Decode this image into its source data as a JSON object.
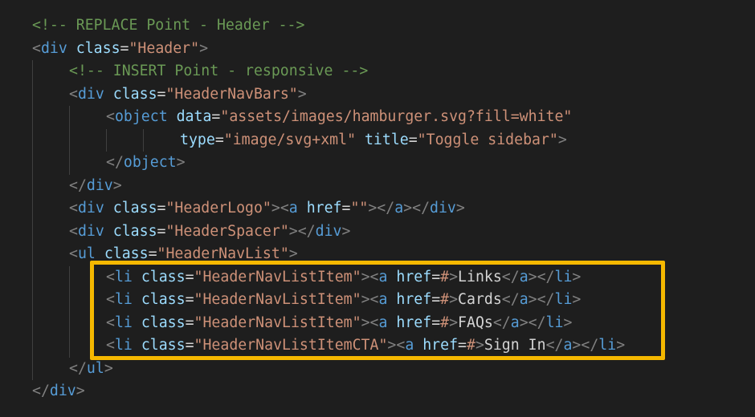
{
  "colors": {
    "background": "#1e1e1e",
    "comment": "#6a9955",
    "bracket": "#808080",
    "tag": "#569cd6",
    "attribute": "#9cdcfe",
    "string": "#ce9178",
    "text": "#d4d4d4",
    "highlight_box": "#f5b800"
  },
  "lines": [
    {
      "tokens": [
        {
          "t": "comment",
          "v": "<!-- REPLACE Point - Header -->"
        }
      ]
    },
    {
      "tokens": [
        {
          "t": "punct",
          "v": "<"
        },
        {
          "t": "tag",
          "v": "div"
        },
        {
          "t": "text",
          "v": " "
        },
        {
          "t": "attr",
          "v": "class"
        },
        {
          "t": "eq",
          "v": "="
        },
        {
          "t": "str",
          "v": "\"Header\""
        },
        {
          "t": "punct",
          "v": ">"
        }
      ]
    },
    {
      "tokens": [
        {
          "t": "comment",
          "v": "<!-- INSERT Point - responsive -->"
        }
      ]
    },
    {
      "tokens": [
        {
          "t": "punct",
          "v": "<"
        },
        {
          "t": "tag",
          "v": "div"
        },
        {
          "t": "text",
          "v": " "
        },
        {
          "t": "attr",
          "v": "class"
        },
        {
          "t": "eq",
          "v": "="
        },
        {
          "t": "str",
          "v": "\"HeaderNavBars\""
        },
        {
          "t": "punct",
          "v": ">"
        }
      ]
    },
    {
      "tokens": [
        {
          "t": "punct",
          "v": "<"
        },
        {
          "t": "tag",
          "v": "object"
        },
        {
          "t": "text",
          "v": " "
        },
        {
          "t": "attr",
          "v": "data"
        },
        {
          "t": "eq",
          "v": "="
        },
        {
          "t": "str",
          "v": "\"assets/images/hamburger.svg?fill=white\""
        }
      ]
    },
    {
      "tokens": [
        {
          "t": "attr",
          "v": "type"
        },
        {
          "t": "eq",
          "v": "="
        },
        {
          "t": "str",
          "v": "\"image/svg+xml\""
        },
        {
          "t": "text",
          "v": " "
        },
        {
          "t": "attr",
          "v": "title"
        },
        {
          "t": "eq",
          "v": "="
        },
        {
          "t": "str",
          "v": "\"Toggle sidebar\""
        },
        {
          "t": "punct",
          "v": ">"
        }
      ]
    },
    {
      "tokens": [
        {
          "t": "punct",
          "v": "</"
        },
        {
          "t": "tag",
          "v": "object"
        },
        {
          "t": "punct",
          "v": ">"
        }
      ]
    },
    {
      "tokens": [
        {
          "t": "punct",
          "v": "</"
        },
        {
          "t": "tag",
          "v": "div"
        },
        {
          "t": "punct",
          "v": ">"
        }
      ]
    },
    {
      "tokens": [
        {
          "t": "punct",
          "v": "<"
        },
        {
          "t": "tag",
          "v": "div"
        },
        {
          "t": "text",
          "v": " "
        },
        {
          "t": "attr",
          "v": "class"
        },
        {
          "t": "eq",
          "v": "="
        },
        {
          "t": "str",
          "v": "\"HeaderLogo\""
        },
        {
          "t": "punct",
          "v": "><"
        },
        {
          "t": "tag",
          "v": "a"
        },
        {
          "t": "text",
          "v": " "
        },
        {
          "t": "attr",
          "v": "href"
        },
        {
          "t": "eq",
          "v": "="
        },
        {
          "t": "str",
          "v": "\"\""
        },
        {
          "t": "punct",
          "v": "></"
        },
        {
          "t": "tag",
          "v": "a"
        },
        {
          "t": "punct",
          "v": "></"
        },
        {
          "t": "tag",
          "v": "div"
        },
        {
          "t": "punct",
          "v": ">"
        }
      ]
    },
    {
      "tokens": [
        {
          "t": "punct",
          "v": "<"
        },
        {
          "t": "tag",
          "v": "div"
        },
        {
          "t": "text",
          "v": " "
        },
        {
          "t": "attr",
          "v": "class"
        },
        {
          "t": "eq",
          "v": "="
        },
        {
          "t": "str",
          "v": "\"HeaderSpacer\""
        },
        {
          "t": "punct",
          "v": "></"
        },
        {
          "t": "tag",
          "v": "div"
        },
        {
          "t": "punct",
          "v": ">"
        }
      ]
    },
    {
      "tokens": [
        {
          "t": "punct",
          "v": "<"
        },
        {
          "t": "tag",
          "v": "ul"
        },
        {
          "t": "text",
          "v": " "
        },
        {
          "t": "attr",
          "v": "class"
        },
        {
          "t": "eq",
          "v": "="
        },
        {
          "t": "str",
          "v": "\"HeaderNavList\""
        },
        {
          "t": "punct",
          "v": ">"
        }
      ]
    },
    {
      "tokens": [
        {
          "t": "punct",
          "v": "<"
        },
        {
          "t": "tag",
          "v": "li"
        },
        {
          "t": "text",
          "v": " "
        },
        {
          "t": "attr",
          "v": "class"
        },
        {
          "t": "eq",
          "v": "="
        },
        {
          "t": "str",
          "v": "\"HeaderNavListItem\""
        },
        {
          "t": "punct",
          "v": "><"
        },
        {
          "t": "tag",
          "v": "a"
        },
        {
          "t": "text",
          "v": " "
        },
        {
          "t": "attr",
          "v": "href"
        },
        {
          "t": "eq",
          "v": "="
        },
        {
          "t": "str",
          "v": "#"
        },
        {
          "t": "punct",
          "v": ">"
        },
        {
          "t": "text",
          "v": "Links"
        },
        {
          "t": "punct",
          "v": "</"
        },
        {
          "t": "tag",
          "v": "a"
        },
        {
          "t": "punct",
          "v": "></"
        },
        {
          "t": "tag",
          "v": "li"
        },
        {
          "t": "punct",
          "v": ">"
        }
      ]
    },
    {
      "tokens": [
        {
          "t": "punct",
          "v": "<"
        },
        {
          "t": "tag",
          "v": "li"
        },
        {
          "t": "text",
          "v": " "
        },
        {
          "t": "attr",
          "v": "class"
        },
        {
          "t": "eq",
          "v": "="
        },
        {
          "t": "str",
          "v": "\"HeaderNavListItem\""
        },
        {
          "t": "punct",
          "v": "><"
        },
        {
          "t": "tag",
          "v": "a"
        },
        {
          "t": "text",
          "v": " "
        },
        {
          "t": "attr",
          "v": "href"
        },
        {
          "t": "eq",
          "v": "="
        },
        {
          "t": "str",
          "v": "#"
        },
        {
          "t": "punct",
          "v": ">"
        },
        {
          "t": "text",
          "v": "Cards"
        },
        {
          "t": "punct",
          "v": "</"
        },
        {
          "t": "tag",
          "v": "a"
        },
        {
          "t": "punct",
          "v": "></"
        },
        {
          "t": "tag",
          "v": "li"
        },
        {
          "t": "punct",
          "v": ">"
        }
      ]
    },
    {
      "tokens": [
        {
          "t": "punct",
          "v": "<"
        },
        {
          "t": "tag",
          "v": "li"
        },
        {
          "t": "text",
          "v": " "
        },
        {
          "t": "attr",
          "v": "class"
        },
        {
          "t": "eq",
          "v": "="
        },
        {
          "t": "str",
          "v": "\"HeaderNavListItem\""
        },
        {
          "t": "punct",
          "v": "><"
        },
        {
          "t": "tag",
          "v": "a"
        },
        {
          "t": "text",
          "v": " "
        },
        {
          "t": "attr",
          "v": "href"
        },
        {
          "t": "eq",
          "v": "="
        },
        {
          "t": "str",
          "v": "#"
        },
        {
          "t": "punct",
          "v": ">"
        },
        {
          "t": "text",
          "v": "FAQs"
        },
        {
          "t": "punct",
          "v": "</"
        },
        {
          "t": "tag",
          "v": "a"
        },
        {
          "t": "punct",
          "v": "></"
        },
        {
          "t": "tag",
          "v": "li"
        },
        {
          "t": "punct",
          "v": ">"
        }
      ]
    },
    {
      "tokens": [
        {
          "t": "punct",
          "v": "<"
        },
        {
          "t": "tag",
          "v": "li"
        },
        {
          "t": "text",
          "v": " "
        },
        {
          "t": "attr",
          "v": "class"
        },
        {
          "t": "eq",
          "v": "="
        },
        {
          "t": "str",
          "v": "\"HeaderNavListItemCTA\""
        },
        {
          "t": "punct",
          "v": "><"
        },
        {
          "t": "tag",
          "v": "a"
        },
        {
          "t": "text",
          "v": " "
        },
        {
          "t": "attr",
          "v": "href"
        },
        {
          "t": "eq",
          "v": "="
        },
        {
          "t": "str",
          "v": "#"
        },
        {
          "t": "punct",
          "v": ">"
        },
        {
          "t": "text",
          "v": "Sign In"
        },
        {
          "t": "punct",
          "v": "</"
        },
        {
          "t": "tag",
          "v": "a"
        },
        {
          "t": "punct",
          "v": "></"
        },
        {
          "t": "tag",
          "v": "li"
        },
        {
          "t": "punct",
          "v": ">"
        }
      ]
    },
    {
      "tokens": [
        {
          "t": "punct",
          "v": "</"
        },
        {
          "t": "tag",
          "v": "ul"
        },
        {
          "t": "punct",
          "v": ">"
        }
      ]
    },
    {
      "tokens": [
        {
          "t": "punct",
          "v": "</"
        },
        {
          "t": "tag",
          "v": "div"
        },
        {
          "t": "punct",
          "v": ">"
        }
      ]
    }
  ]
}
